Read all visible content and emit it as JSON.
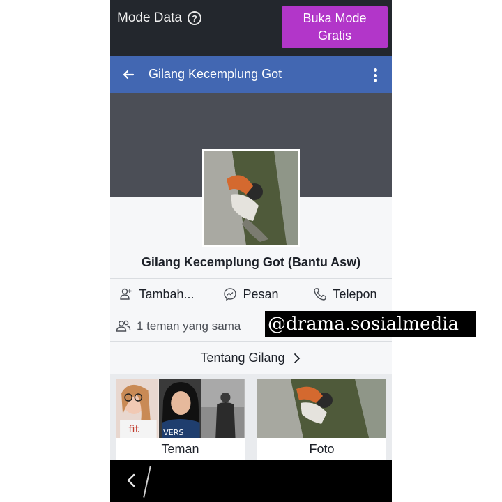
{
  "status_bar": {
    "mode_label": "Mode Data",
    "help_icon": "question-circle-icon",
    "free_mode_button": "Buka Mode\nGratis",
    "free_mode_color": "#b236c9"
  },
  "app_bar": {
    "title": "Gilang Kecemplung Got",
    "back_icon": "arrow-left-icon",
    "menu_icon": "more-vertical-icon",
    "color": "#4267b2"
  },
  "profile": {
    "name": "Gilang Kecemplung Got (Bantu Asw)"
  },
  "actions": [
    {
      "label": "Tambah...",
      "icon": "add-friend-icon"
    },
    {
      "label": "Pesan",
      "icon": "messenger-icon"
    },
    {
      "label": "Telepon",
      "icon": "phone-icon"
    }
  ],
  "mutual_friends": {
    "label": "1 teman yang sama",
    "icon": "friends-icon"
  },
  "about": {
    "label": "Tentang Gilang",
    "icon": "chevron-right-icon"
  },
  "tiles": {
    "friends_label": "Teman",
    "photos_label": "Foto"
  },
  "watermark": "@drama.sosialmedia"
}
